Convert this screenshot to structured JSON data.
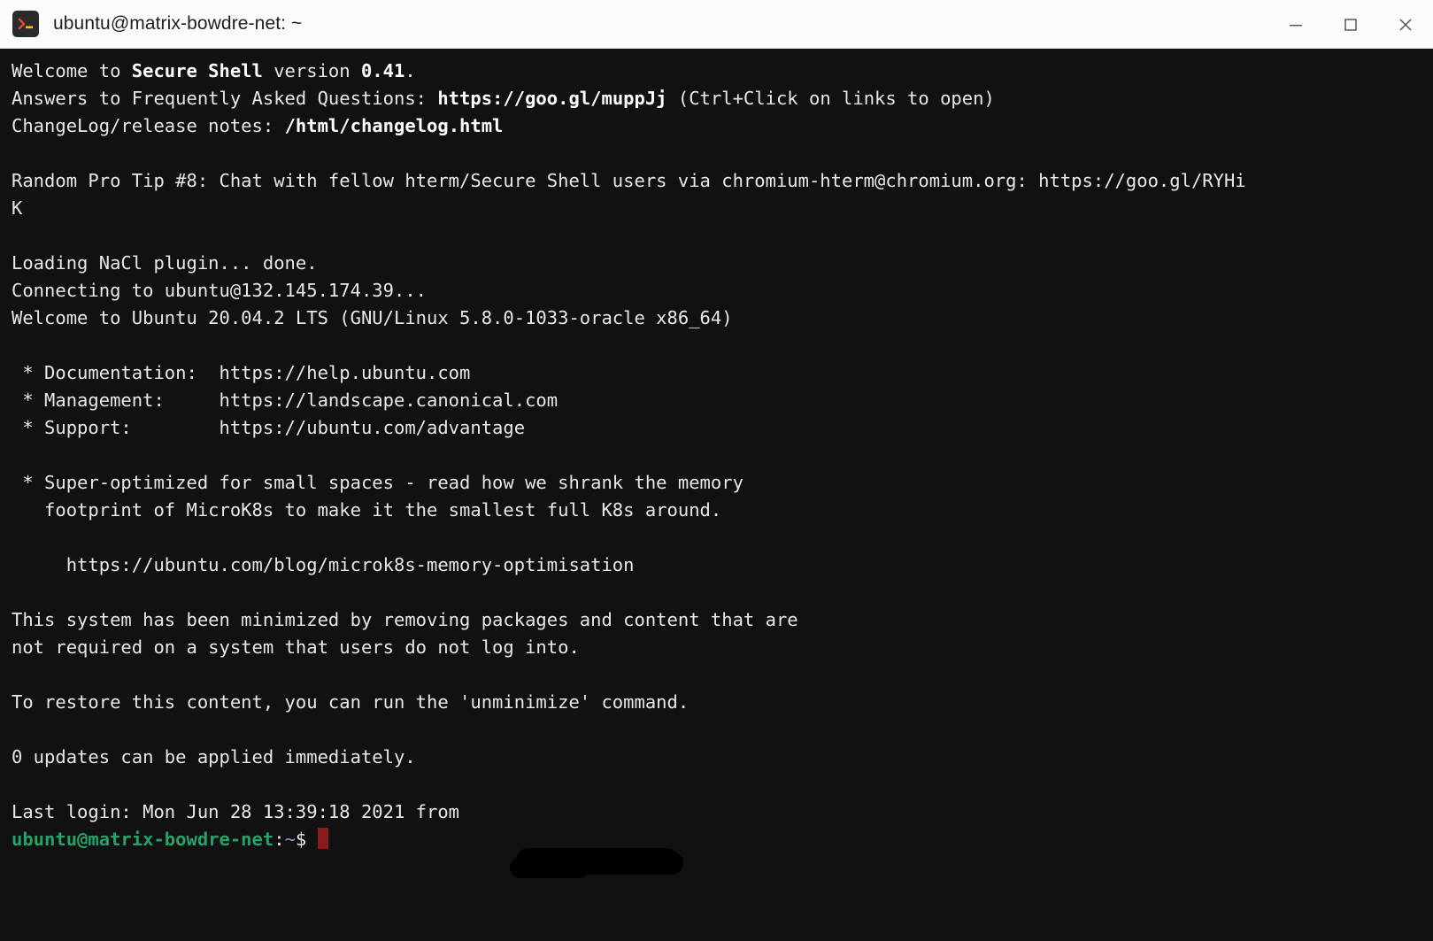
{
  "window": {
    "title": "ubuntu@matrix-bowdre-net: ~",
    "app_icon": "terminal-prompt-icon",
    "controls": {
      "minimize": "minimize-icon",
      "maximize": "maximize-icon",
      "close": "close-icon"
    }
  },
  "terminal": {
    "background": "#111111",
    "foreground": "#e8e8e8",
    "prompt_color": "#26a269",
    "cursor_color": "#8b1a1a",
    "lines": [
      {
        "segments": [
          {
            "t": "Welcome to ",
            "s": ""
          },
          {
            "t": "Secure Shell",
            "s": "b"
          },
          {
            "t": " version ",
            "s": ""
          },
          {
            "t": "0.41",
            "s": "b"
          },
          {
            "t": ".",
            "s": ""
          }
        ]
      },
      {
        "segments": [
          {
            "t": "Answers to Frequently Asked Questions: ",
            "s": ""
          },
          {
            "t": "https://goo.gl/muppJj",
            "s": "b"
          },
          {
            "t": " (Ctrl+Click on links to open)",
            "s": ""
          }
        ]
      },
      {
        "segments": [
          {
            "t": "ChangeLog/release notes: ",
            "s": ""
          },
          {
            "t": "/html/changelog.html",
            "s": "b"
          }
        ]
      },
      {
        "segments": [
          {
            "t": "",
            "s": ""
          }
        ]
      },
      {
        "segments": [
          {
            "t": "Random Pro Tip #8: Chat with fellow hterm/Secure Shell users via chromium-hterm@chromium.org: https://goo.gl/RYHi",
            "s": ""
          }
        ]
      },
      {
        "segments": [
          {
            "t": "K",
            "s": ""
          }
        ]
      },
      {
        "segments": [
          {
            "t": "",
            "s": ""
          }
        ]
      },
      {
        "segments": [
          {
            "t": "Loading NaCl plugin... done.",
            "s": ""
          }
        ]
      },
      {
        "segments": [
          {
            "t": "Connecting to ubuntu@132.145.174.39...",
            "s": ""
          }
        ]
      },
      {
        "segments": [
          {
            "t": "Welcome to Ubuntu 20.04.2 LTS (GNU/Linux 5.8.0-1033-oracle x86_64)",
            "s": ""
          }
        ]
      },
      {
        "segments": [
          {
            "t": "",
            "s": ""
          }
        ]
      },
      {
        "segments": [
          {
            "t": " * Documentation:  https://help.ubuntu.com",
            "s": ""
          }
        ]
      },
      {
        "segments": [
          {
            "t": " * Management:     https://landscape.canonical.com",
            "s": ""
          }
        ]
      },
      {
        "segments": [
          {
            "t": " * Support:        https://ubuntu.com/advantage",
            "s": ""
          }
        ]
      },
      {
        "segments": [
          {
            "t": "",
            "s": ""
          }
        ]
      },
      {
        "segments": [
          {
            "t": " * Super-optimized for small spaces - read how we shrank the memory",
            "s": ""
          }
        ]
      },
      {
        "segments": [
          {
            "t": "   footprint of MicroK8s to make it the smallest full K8s around.",
            "s": ""
          }
        ]
      },
      {
        "segments": [
          {
            "t": "",
            "s": ""
          }
        ]
      },
      {
        "segments": [
          {
            "t": "     https://ubuntu.com/blog/microk8s-memory-optimisation",
            "s": ""
          }
        ]
      },
      {
        "segments": [
          {
            "t": "",
            "s": ""
          }
        ]
      },
      {
        "segments": [
          {
            "t": "This system has been minimized by removing packages and content that are",
            "s": ""
          }
        ]
      },
      {
        "segments": [
          {
            "t": "not required on a system that users do not log into.",
            "s": ""
          }
        ]
      },
      {
        "segments": [
          {
            "t": "",
            "s": ""
          }
        ]
      },
      {
        "segments": [
          {
            "t": "To restore this content, you can run the 'unminimize' command.",
            "s": ""
          }
        ]
      },
      {
        "segments": [
          {
            "t": "",
            "s": ""
          }
        ]
      },
      {
        "segments": [
          {
            "t": "0 updates can be applied immediately.",
            "s": ""
          }
        ]
      },
      {
        "segments": [
          {
            "t": "",
            "s": ""
          }
        ]
      },
      {
        "segments": [
          {
            "t": "Last login: Mon Jun 28 13:39:18 2021 from ",
            "s": ""
          }
        ]
      },
      {
        "segments": [
          {
            "t": "ubuntu@matrix-bowdre-net",
            "s": "green-b"
          },
          {
            "t": ":",
            "s": "white"
          },
          {
            "t": "~",
            "s": "blue"
          },
          {
            "t": "$ ",
            "s": "white"
          }
        ],
        "cursor": true
      }
    ]
  }
}
